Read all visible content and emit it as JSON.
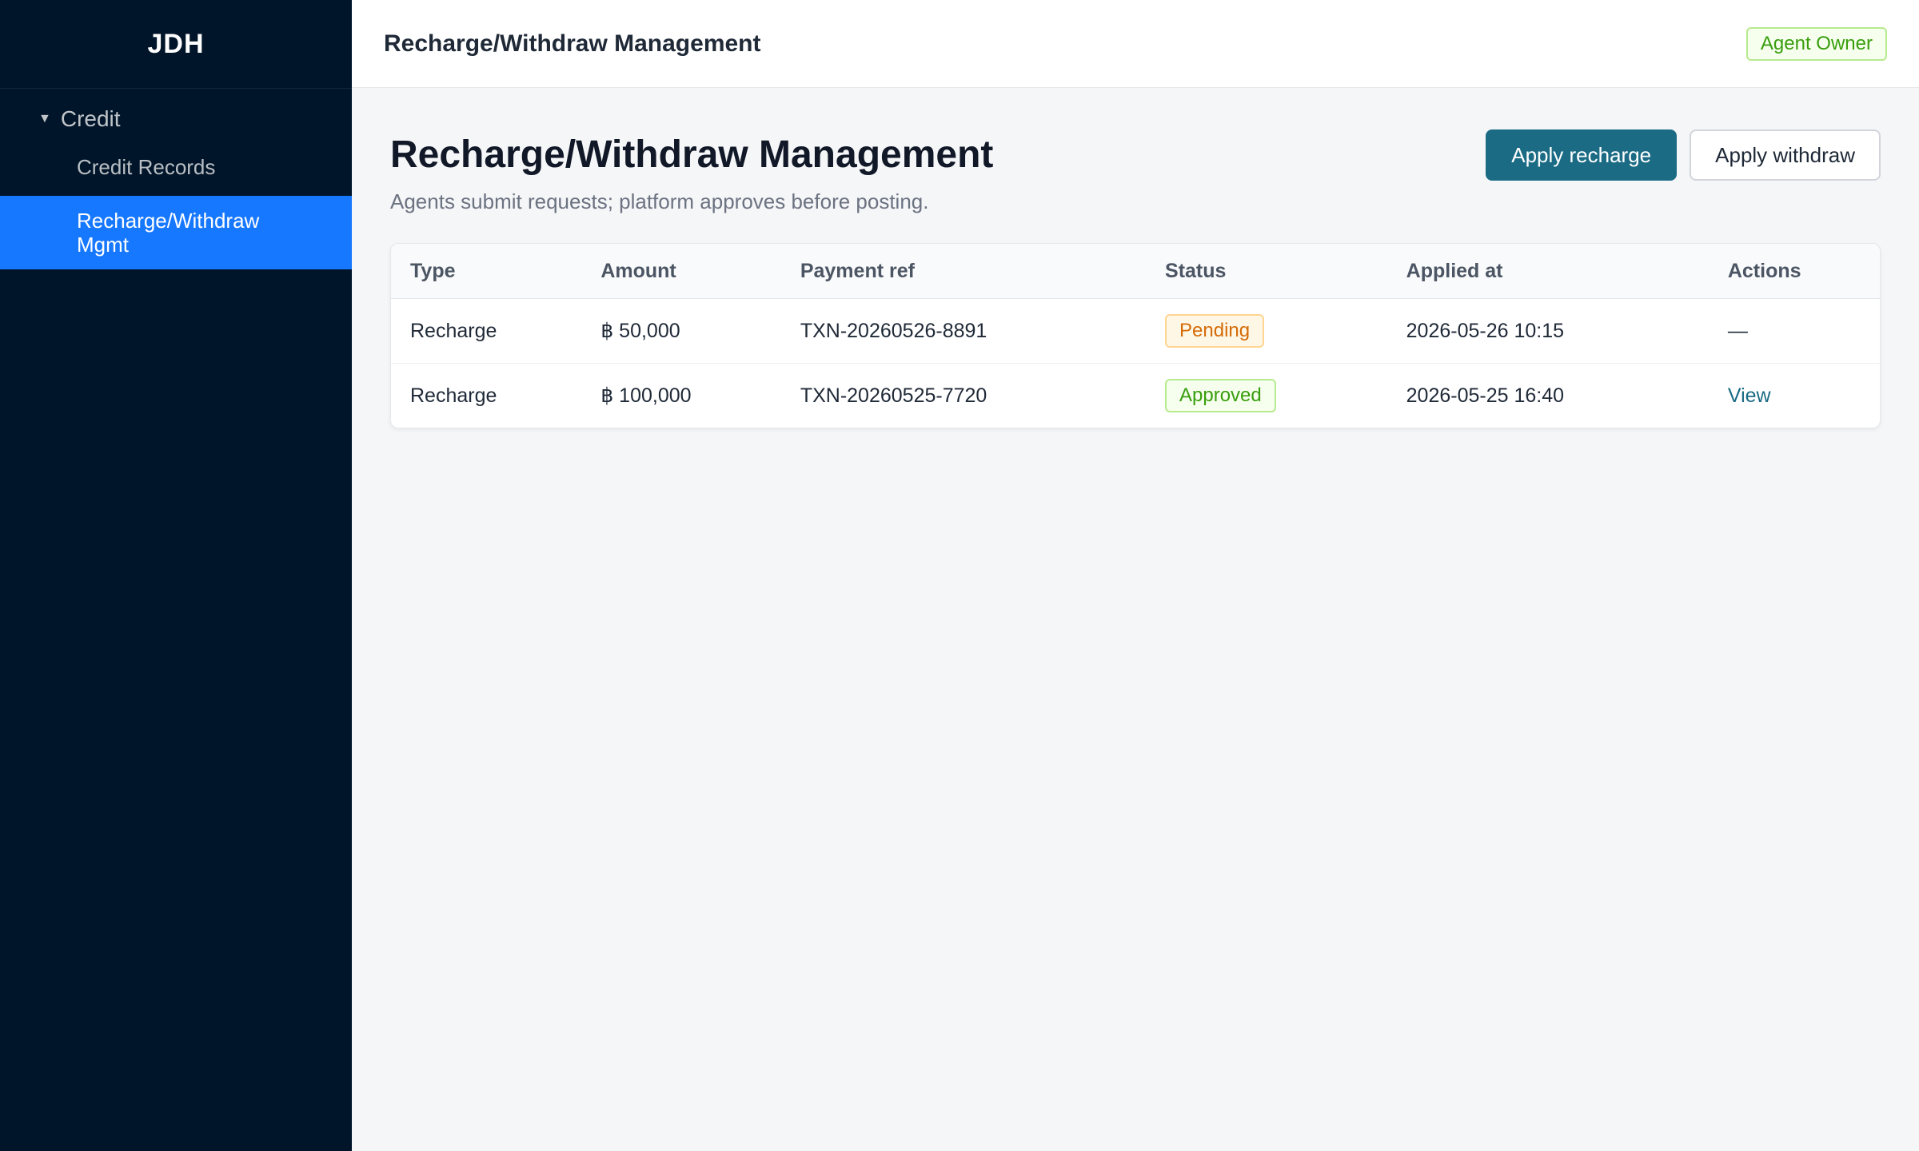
{
  "sidebar": {
    "brand": "JDH",
    "group_label": "Credit",
    "items": [
      {
        "label": "Credit Records"
      },
      {
        "label": "Recharge/Withdraw Mgmt"
      }
    ]
  },
  "topbar": {
    "title": "Recharge/Withdraw Management",
    "role": "Agent Owner"
  },
  "page": {
    "title": "Recharge/Withdraw Management",
    "subtitle": "Agents submit requests; platform approves before posting.",
    "apply_recharge_label": "Apply recharge",
    "apply_withdraw_label": "Apply withdraw"
  },
  "table": {
    "columns": [
      "Type",
      "Amount",
      "Payment ref",
      "Status",
      "Applied at",
      "Actions"
    ],
    "rows": [
      {
        "type": "Recharge",
        "amount": "฿ 50,000",
        "payment_ref": "TXN-20260526-8891",
        "status": "Pending",
        "applied_at": "2026-05-26 10:15",
        "action": "—"
      },
      {
        "type": "Recharge",
        "amount": "฿ 100,000",
        "payment_ref": "TXN-20260525-7720",
        "status": "Approved",
        "applied_at": "2026-05-25 16:40",
        "action": "View"
      }
    ]
  },
  "colors": {
    "sidebar_bg": "#001529",
    "active_item": "#1677ff",
    "primary_button": "#1b6b85",
    "pending": "#d46b08",
    "approved": "#389e0d"
  },
  "icons": {
    "group_caret": "caret-down-icon"
  }
}
